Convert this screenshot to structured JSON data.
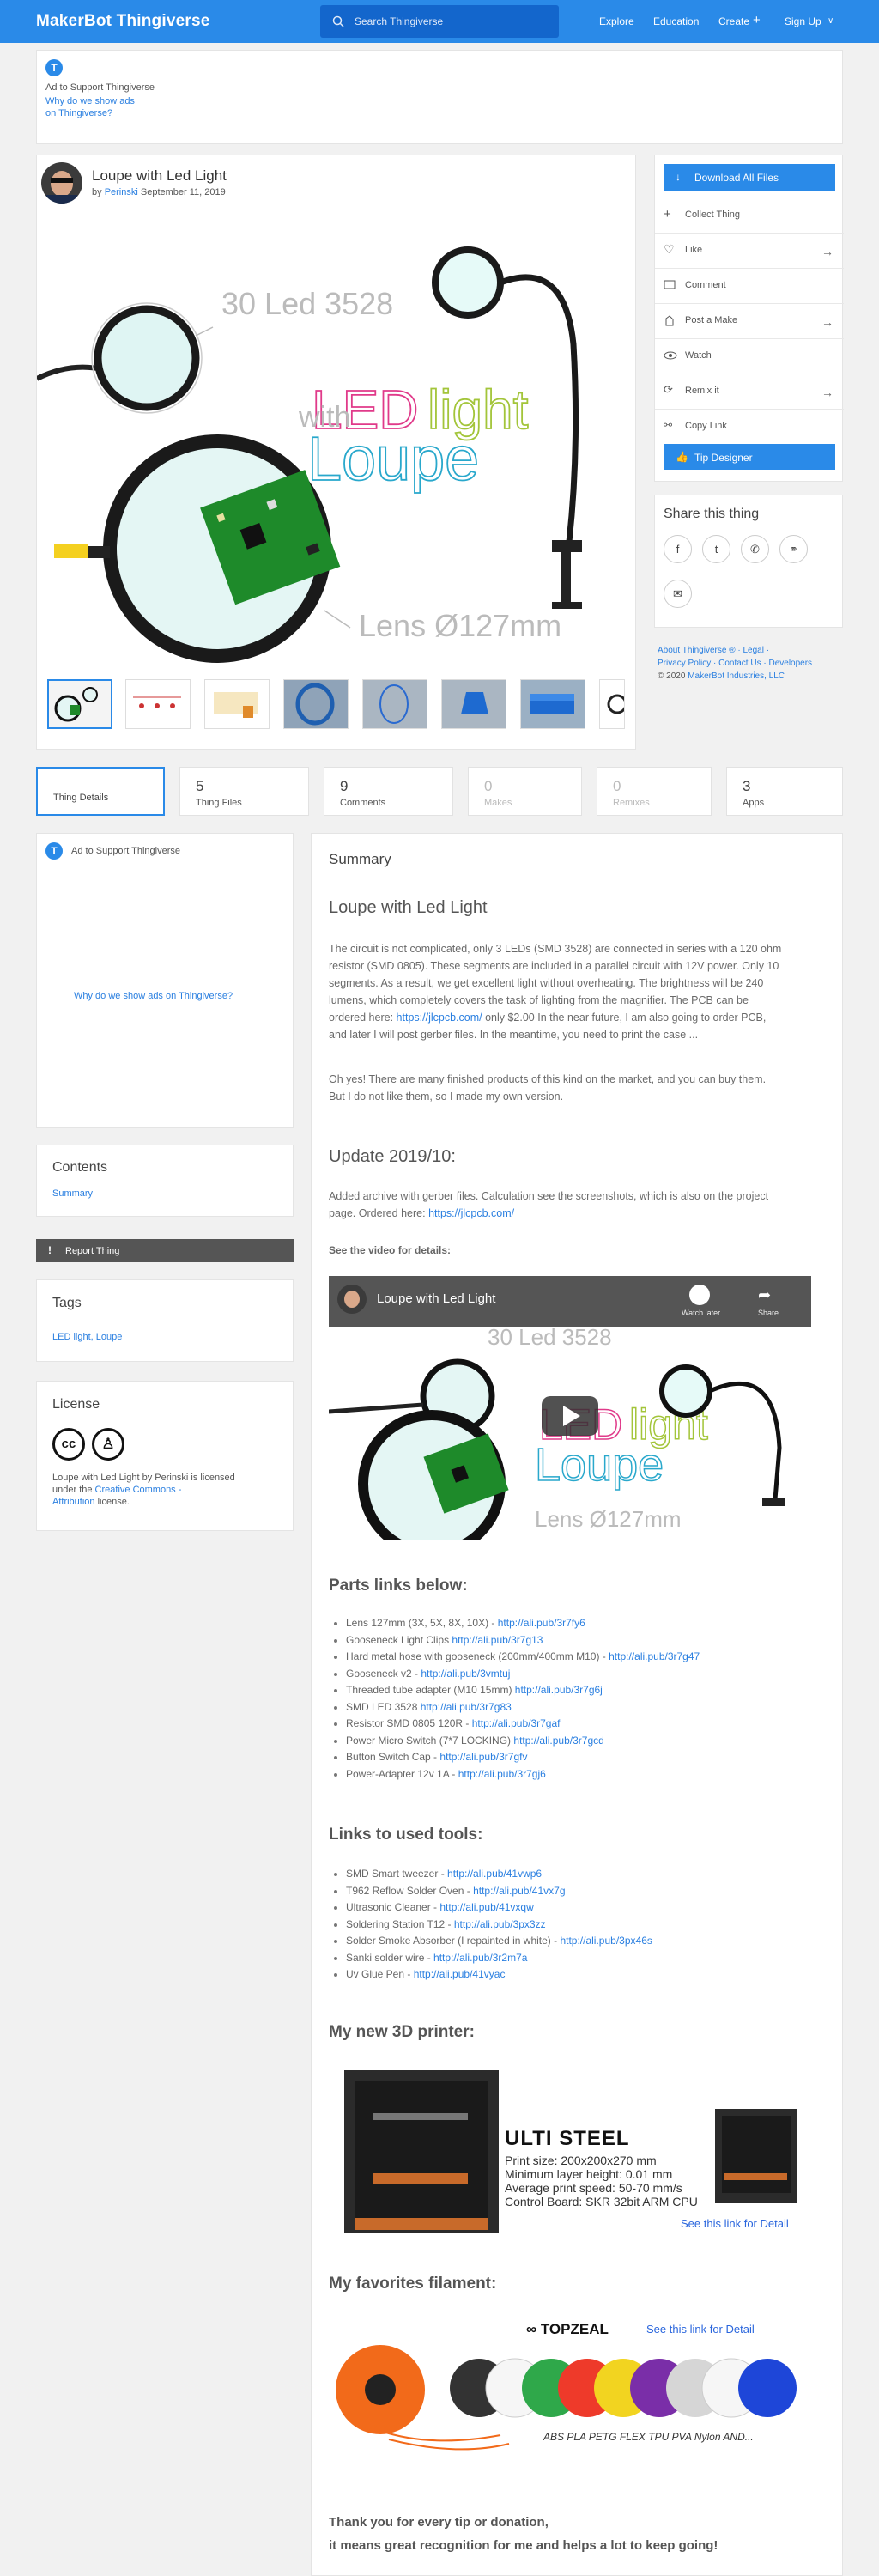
{
  "header": {
    "logo": "MakerBot Thingiverse",
    "search_placeholder": "Search Thingiverse",
    "nav": [
      "Explore",
      "Education",
      "Create",
      "Sign Up"
    ]
  },
  "ad_top": {
    "label": "Ad to Support Thingiverse",
    "why": "Why do we show ads",
    "why2": "on Thingiverse?"
  },
  "thing": {
    "title": "Loupe with Led Light",
    "by": "by",
    "author": "Perinski",
    "date": "September 11, 2019"
  },
  "image": {
    "led_text": "30 Led 3528",
    "lens_text": "Lens Ø127mm",
    "word_led": "LED",
    "word_with": "with",
    "word_light": "light",
    "word_loupe": "Loupe"
  },
  "actions": {
    "download": "Download All Files",
    "items": [
      "Collect Thing",
      "Like",
      "Comment",
      "Post a Make",
      "Watch",
      "Remix it",
      "Copy Link"
    ],
    "tip": "Tip Designer"
  },
  "share": {
    "title": "Share this thing"
  },
  "footer_links": {
    "line1": "About Thingiverse ® · Legal ·",
    "line2": "Privacy Policy · Contact Us · Developers",
    "line3": "© 2020",
    "line3_link": "MakerBot Industries, LLC"
  },
  "tabs": [
    {
      "label": "Thing Details"
    },
    {
      "num": "5",
      "label": "Thing Files"
    },
    {
      "num": "9",
      "label": "Comments"
    },
    {
      "num": "0",
      "label": "Makes"
    },
    {
      "num": "0",
      "label": "Remixes"
    },
    {
      "num": "3",
      "label": "Apps"
    }
  ],
  "ad_side": {
    "label": "Ad to Support Thingiverse",
    "why": "Why do we show ads on Thingiverse?"
  },
  "contents": {
    "title": "Contents",
    "item": "Summary"
  },
  "report": {
    "label": "Report Thing"
  },
  "tags": {
    "title": "Tags",
    "list": "LED light, Loupe"
  },
  "license": {
    "title": "License",
    "text1": "Loupe with Led Light by Perinski is licensed",
    "text2": "under the",
    "link": "Creative Commons -",
    "link2": "Attribution",
    "text3": "license."
  },
  "summary": {
    "heading": "Summary",
    "title": "Loupe with Led Light",
    "p1": [
      "The circuit is not complicated, only 3 LEDs (SMD 3528) are connected in series with a 120 ohm",
      "resistor (SMD 0805). These segments are included in a parallel circuit with 12V power. Only 10",
      "segments. As a result, we get excellent light without overheating. The brightness will be 240",
      "lumens, which completely covers the task of lighting from the magnifier. The PCB can be",
      "ordered here:",
      "https://jlcpcb.com/",
      "only $2.00 In the near future, I am also going to order PCB,",
      "and later I will post gerber files. In the meantime, you need to print the case ..."
    ],
    "p2": [
      "Oh yes! There are many finished products of this kind on the market, and you can buy them.",
      "But I do not like them, so I made my own version."
    ],
    "update_title": "Update 2019/10:",
    "update": [
      "Added archive with gerber files. Calculation see the screenshots, which is also on the project",
      "page. Ordered here:",
      "https://jlcpcb.com/"
    ],
    "video_label": "See the video for details:",
    "video_title": "Loupe with Led Light",
    "video_later": "Watch later",
    "video_share": "Share",
    "parts_title": "Parts links below:",
    "parts": [
      [
        "Lens 127mm (3X, 5X, 8X, 10X) - ",
        "http://ali.pub/3r7fy6"
      ],
      [
        "Gooseneck Light Clips ",
        "http://ali.pub/3r7g13"
      ],
      [
        "Hard metal hose with gooseneck (200mm/400mm M10) - ",
        "http://ali.pub/3r7g47"
      ],
      [
        "Gooseneck v2 - ",
        "http://ali.pub/3vmtuj"
      ],
      [
        "Threaded tube adapter (M10 15mm) ",
        "http://ali.pub/3r7g6j"
      ],
      [
        "SMD LED 3528 ",
        "http://ali.pub/3r7g83"
      ],
      [
        "Resistor SMD 0805 120R - ",
        "http://ali.pub/3r7gaf"
      ],
      [
        "Power Micro Switch (7*7 LOCKING) ",
        "http://ali.pub/3r7gcd"
      ],
      [
        "Button Switch Cap - ",
        "http://ali.pub/3r7gfv"
      ],
      [
        "Power-Adapter 12v 1A - ",
        "http://ali.pub/3r7gj6"
      ]
    ],
    "tools_title": "Links to used tools:",
    "tools": [
      [
        "SMD Smart tweezer - ",
        "http://ali.pub/41vwp6"
      ],
      [
        "T962 Reflow Solder Oven - ",
        "http://ali.pub/41vx7g"
      ],
      [
        "Ultrasonic Cleaner - ",
        "http://ali.pub/41vxqw"
      ],
      [
        "Soldering Station T12 - ",
        "http://ali.pub/3px3zz"
      ],
      [
        "Solder Smoke Absorber (I repainted in white) - ",
        "http://ali.pub/3px46s"
      ],
      [
        "Sanki solder wire - ",
        "http://ali.pub/3r2m7a"
      ],
      [
        "Uv Glue Pen - ",
        "http://ali.pub/41vyac"
      ]
    ],
    "printer_title": "My new 3D printer:",
    "printer": {
      "name": "ULTI STEEL",
      "specs": [
        "Print size: 200x200x270 mm",
        "Minimum layer height: 0.01 mm",
        "Average print speed: 50-70 mm/s",
        "Control Board: SKR 32bit ARM CPU"
      ],
      "link": "See this link for Detail"
    },
    "filament_title": "My favorites filament:",
    "filament": {
      "brand": "TOPZEAL",
      "link": "See this link for Detail",
      "types": "ABS PLA PETG FLEX TPU PVA Nylon AND..."
    },
    "thanks": [
      "Thank you for every tip or donation,",
      "it means great recognition for me and helps a lot to keep going!"
    ]
  }
}
